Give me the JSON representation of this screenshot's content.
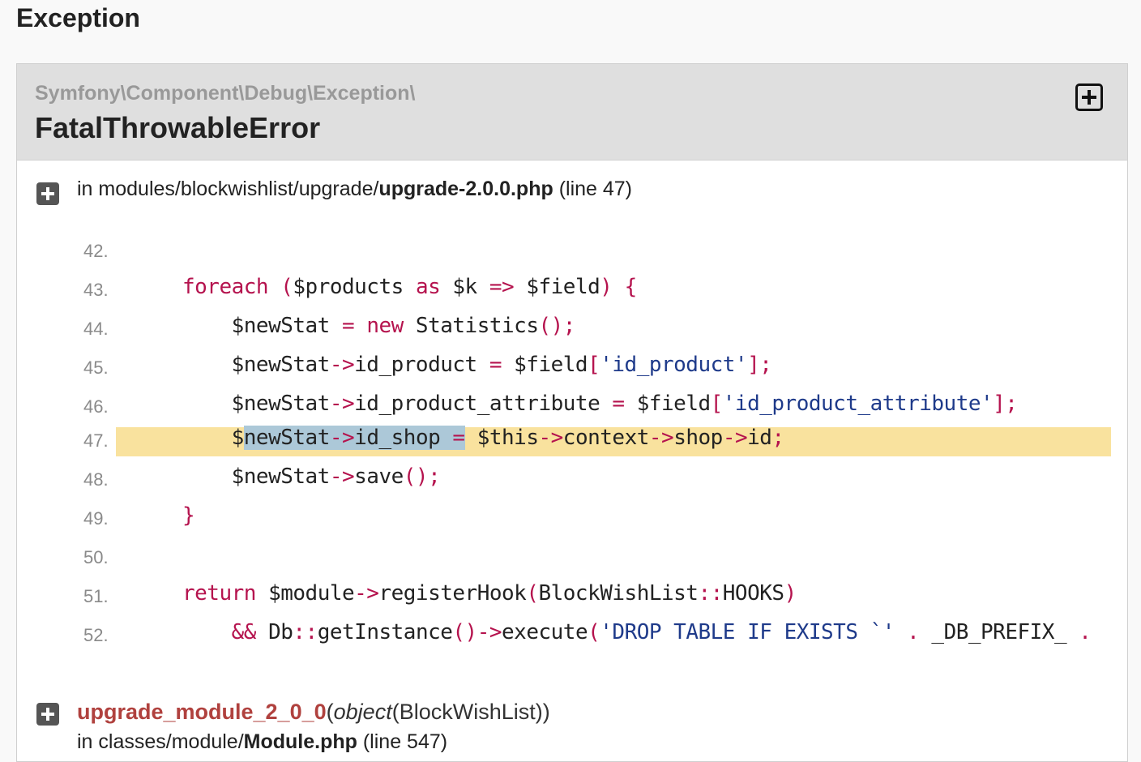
{
  "page": {
    "title": "Exception"
  },
  "exception": {
    "namespace": "Symfony\\Component\\Debug\\Exception\\",
    "class_name": "FatalThrowableError"
  },
  "location": {
    "prefix": "in modules/blockwishlist/upgrade/",
    "file": "upgrade-2.0.0.php",
    "line_info": "(line 47)"
  },
  "code": {
    "highlighted_line": "47",
    "lines": [
      {
        "number": "42.",
        "text": ""
      },
      {
        "number": "43.",
        "text": "    foreach ($products as $k => $field) {"
      },
      {
        "number": "44.",
        "text": "        $newStat = new Statistics();"
      },
      {
        "number": "45.",
        "text": "        $newStat->id_product = $field['id_product'];"
      },
      {
        "number": "46.",
        "text": "        $newStat->id_product_attribute = $field['id_product_attribute'];"
      },
      {
        "number": "47.",
        "text": "        $newStat->id_shop = $this->context->shop->id;"
      },
      {
        "number": "48.",
        "text": "        $newStat->save();"
      },
      {
        "number": "49.",
        "text": "    }"
      },
      {
        "number": "50.",
        "text": ""
      },
      {
        "number": "51.",
        "text": "    return $module->registerHook(BlockWishList::HOOKS)"
      },
      {
        "number": "52.",
        "text": "        && Db::getInstance()->execute('DROP TABLE IF EXISTS `' . _DB_PREFIX_ ."
      }
    ]
  },
  "frame": {
    "function": "upgrade_module_2_0_0",
    "args_open": "(",
    "args_type": "object",
    "args_value": "(BlockWishList))",
    "location_prefix": "in classes/module/",
    "file": "Module.php",
    "line_info": "(line 547)"
  }
}
